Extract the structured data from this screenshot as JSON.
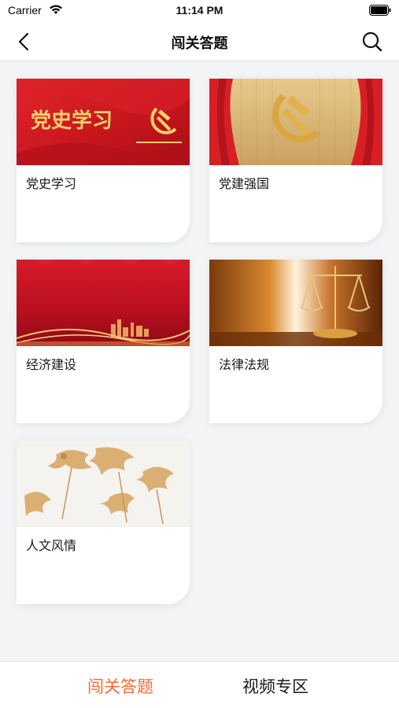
{
  "status_bar": {
    "carrier": "Carrier",
    "time": "11:14 PM",
    "icons": [
      "wifi-icon",
      "battery-icon"
    ]
  },
  "nav": {
    "title": "闯关答题",
    "back_icon": "chevron-left-icon",
    "search_icon": "search-icon"
  },
  "categories": [
    {
      "label": "党史学习",
      "image_text": "党史学习",
      "image": "party-history-banner"
    },
    {
      "label": "党建强国",
      "image": "party-emblem-curtain"
    },
    {
      "label": "经济建设",
      "image": "red-stage-skyline"
    },
    {
      "label": "法律法规",
      "image": "scales-of-justice"
    },
    {
      "label": "人文风情",
      "image": "paper-cut-figures"
    }
  ],
  "tabs": [
    {
      "label": "闯关答题",
      "active": true
    },
    {
      "label": "视频专区",
      "active": false
    }
  ],
  "colors": {
    "accent": "#f26b3a",
    "party_red": "#c8161d",
    "gold": "#e8b64c",
    "background": "#f3f4f6"
  }
}
